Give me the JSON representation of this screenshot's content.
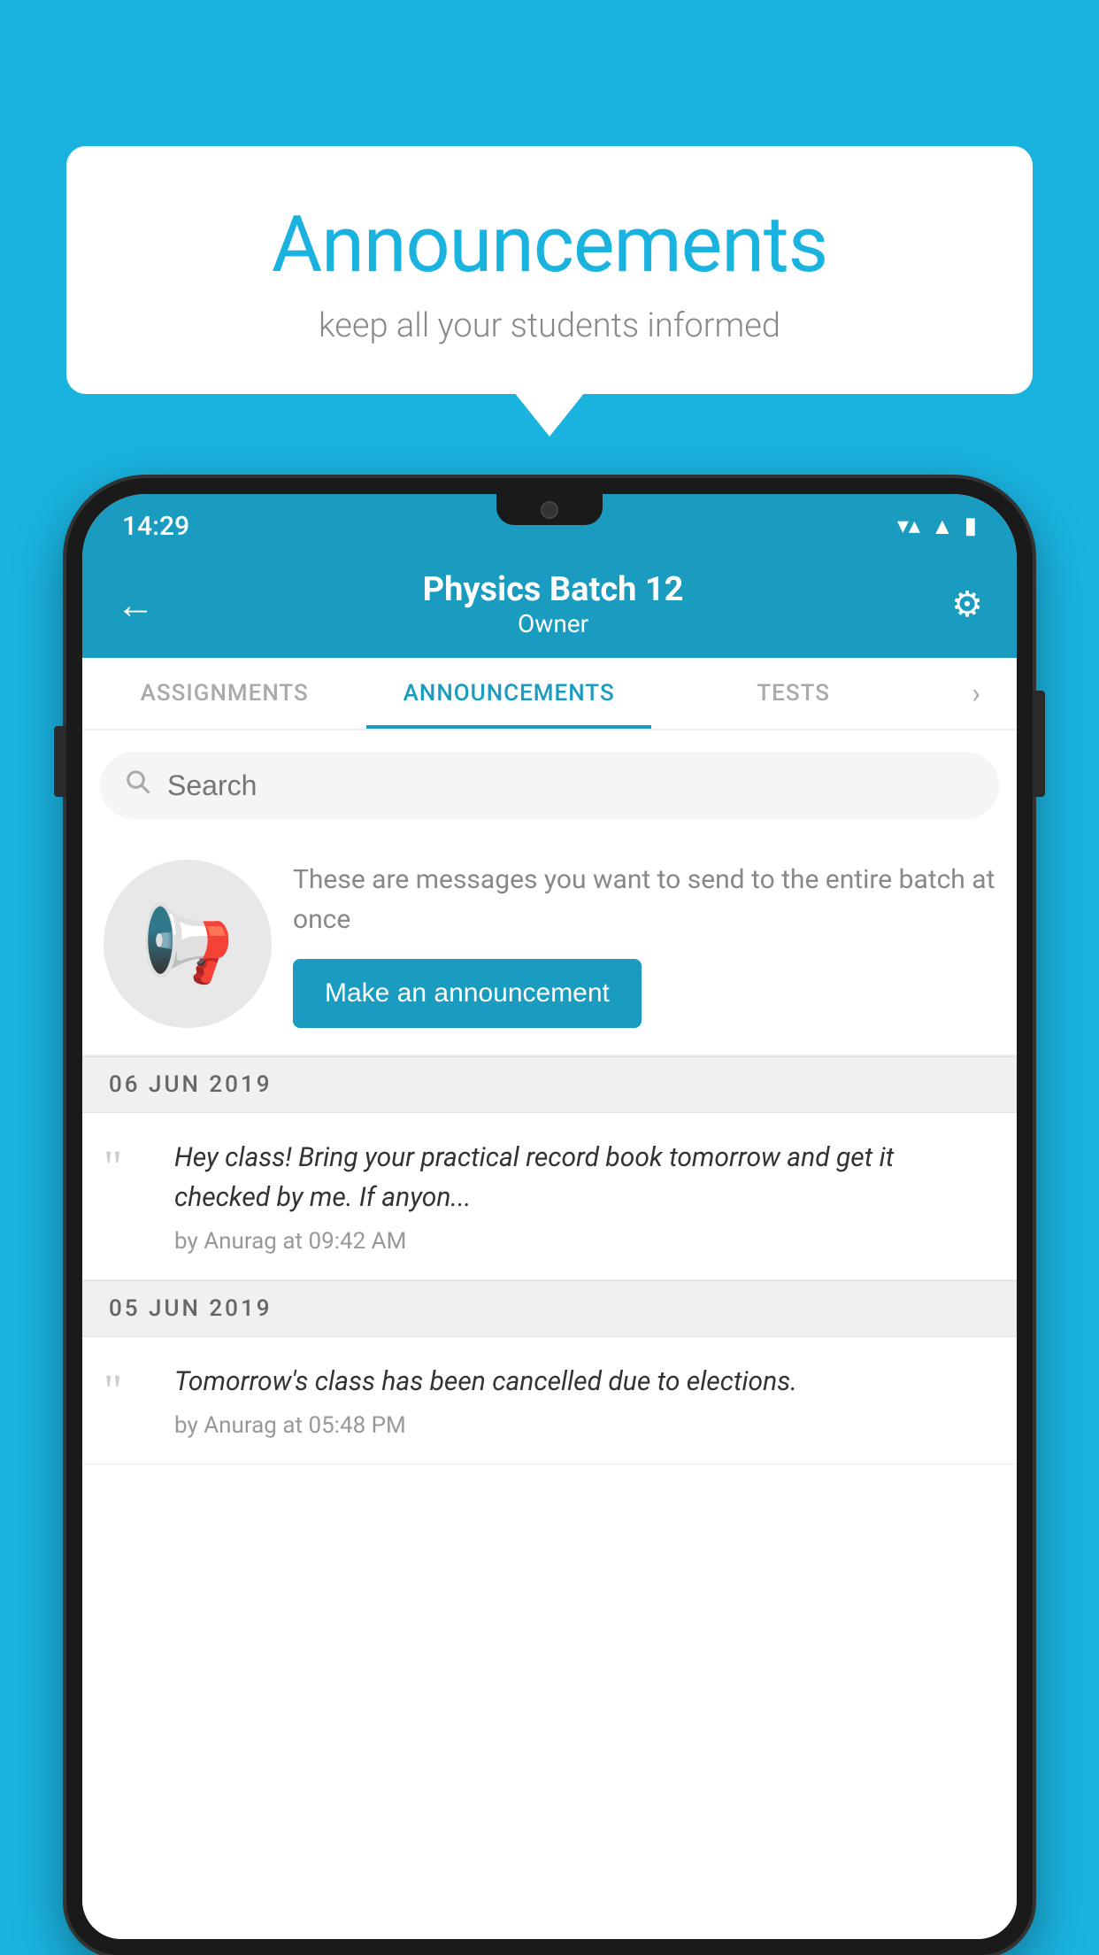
{
  "background_color": "#1ab3e0",
  "speech_bubble": {
    "title": "Announcements",
    "subtitle": "keep all your students informed"
  },
  "status_bar": {
    "time": "14:29",
    "wifi": "▼",
    "signal": "▲",
    "battery": "▮"
  },
  "app_bar": {
    "title": "Physics Batch 12",
    "subtitle": "Owner",
    "back_label": "←",
    "settings_label": "⚙"
  },
  "tabs": [
    {
      "id": "assignments",
      "label": "ASSIGNMENTS",
      "active": false
    },
    {
      "id": "announcements",
      "label": "ANNOUNCEMENTS",
      "active": true
    },
    {
      "id": "tests",
      "label": "TESTS",
      "active": false
    }
  ],
  "search": {
    "placeholder": "Search",
    "icon": "🔍"
  },
  "promo": {
    "description_text": "These are messages you want to send to the entire batch at once",
    "button_label": "Make an announcement"
  },
  "announcements": [
    {
      "date": "06  JUN  2019",
      "items": [
        {
          "text": "Hey class! Bring your practical record book tomorrow and get it checked by me. If anyon...",
          "meta": "by Anurag at 09:42 AM"
        }
      ]
    },
    {
      "date": "05  JUN  2019",
      "items": [
        {
          "text": "Tomorrow's class has been cancelled due to elections.",
          "meta": "by Anurag at 05:48 PM"
        }
      ]
    }
  ]
}
